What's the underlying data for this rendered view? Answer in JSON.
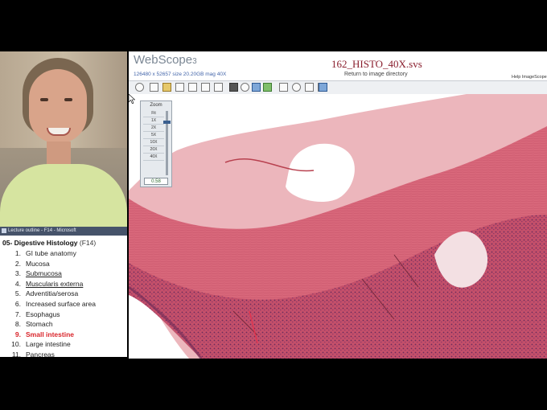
{
  "viewer": {
    "app_title": "WebScope",
    "app_version": "3",
    "file_info": "126480 x 52657 size 20.20GB mag 40X",
    "file_name": "162_HISTO_40X.svs",
    "return_link": "Return to image directory",
    "help_link": "Help  ImageScope",
    "zoom": {
      "title": "Zoom",
      "levels": [
        "Fit",
        "1X",
        "2X",
        "5X",
        "10X",
        "20X",
        "40X"
      ],
      "current_level_fraction": 0.15,
      "value": "0.58"
    }
  },
  "outline": {
    "window_title": "Lecture outline - F14 - Microsoft",
    "heading": "05- Digestive Histology",
    "heading_suffix": "(F14)",
    "items": [
      {
        "num": "1.",
        "label": "GI tube anatomy"
      },
      {
        "num": "2.",
        "label": "Mucosa"
      },
      {
        "num": "3.",
        "label": "Submucosa"
      },
      {
        "num": "4.",
        "label": "Muscularis externa"
      },
      {
        "num": "5.",
        "label": "Adventitia/serosa"
      },
      {
        "num": "6.",
        "label": "Increased surface area"
      },
      {
        "num": "7.",
        "label": "Esophagus"
      },
      {
        "num": "8.",
        "label": "Stomach"
      },
      {
        "num": "9.",
        "label": "Small intestine"
      },
      {
        "num": "10.",
        "label": "Large intestine"
      },
      {
        "num": "11.",
        "label": "Pancreas"
      }
    ],
    "active_index": 8
  },
  "icons": {
    "toolbar": [
      "home-icon",
      "save-icon",
      "scale-icon",
      "zoom-to-box-icon",
      "thumbnail-icon",
      "image-icon",
      "snapshot-icon",
      "pan-icon",
      "rotate-icon",
      "pen-icon",
      "ruler-icon",
      "rectangle-icon",
      "ellipse-icon",
      "arrow-icon",
      "freehand-icon",
      "annotation-list-icon"
    ]
  },
  "colors": {
    "active_item": "#d9242a",
    "file_name": "#8a1f2e",
    "tissue_muscle": "#d45c6e",
    "tissue_mucosa": "#b9475f"
  }
}
